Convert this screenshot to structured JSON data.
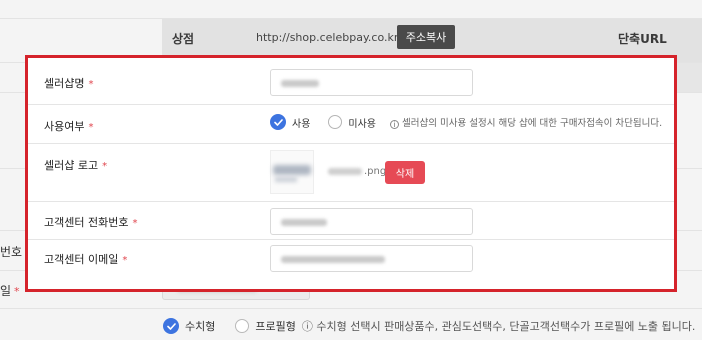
{
  "background": {
    "shop_label": "상점",
    "shop_url": "http://shop.celebpay.co.kr/gcone",
    "copy_button": "주소복사",
    "short_url_label": "단축URL",
    "partial_label_phone": "번호",
    "partial_label_email": "일",
    "required_mark": "*",
    "mode_options": [
      "수치형",
      "프로필형"
    ],
    "mode_selected": "수치형",
    "mode_info": "수치형 선택시 판매상품수, 관심도선택수, 단골고객선택수가 프로필에 노출 됩니다."
  },
  "modal": {
    "required_mark": "*",
    "fields": {
      "name": {
        "label": "셀러샵명"
      },
      "usage": {
        "label": "사용여부",
        "options": [
          "사용",
          "미사용"
        ],
        "selected": "사용",
        "info": "셀러샵의 미사용 설정시 해당 샵에 대한 구매자접속이 차단됩니다.",
        "info_icon": "ⓘ"
      },
      "logo": {
        "label": "셀러샵 로고",
        "file_ext": ".png",
        "delete_button": "삭제"
      },
      "phone": {
        "label": "고객센터 전화번호"
      },
      "email": {
        "label": "고객센터 이메일"
      }
    }
  },
  "colors": {
    "accent_blue": "#3d74e0",
    "danger_red": "#e64a55",
    "highlight_border": "#d5232b",
    "required_red": "#e0454d"
  }
}
